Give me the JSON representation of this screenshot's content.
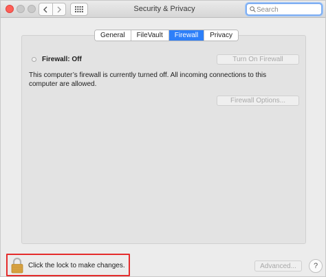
{
  "window": {
    "title": "Security & Privacy"
  },
  "search": {
    "placeholder": "Search",
    "value": ""
  },
  "tabs": [
    {
      "label": "General",
      "active": false
    },
    {
      "label": "FileVault",
      "active": false
    },
    {
      "label": "Firewall",
      "active": true
    },
    {
      "label": "Privacy",
      "active": false
    }
  ],
  "firewall": {
    "status": "Firewall: Off",
    "turn_on_label": "Turn On Firewall",
    "description": "This computer’s firewall is currently turned off. All incoming connections to this computer are allowed.",
    "options_label": "Firewall Options..."
  },
  "footer": {
    "lock_text": "Click the lock to make changes.",
    "advanced_label": "Advanced...",
    "help_label": "?"
  },
  "colors": {
    "accent": "#2d7ff9",
    "close": "#fe5f57",
    "highlight": "#e52b2b",
    "lock": "#d9a441"
  },
  "icons": [
    "chevron-left-icon",
    "chevron-right-icon",
    "grid-icon",
    "search-icon",
    "lock-icon"
  ]
}
